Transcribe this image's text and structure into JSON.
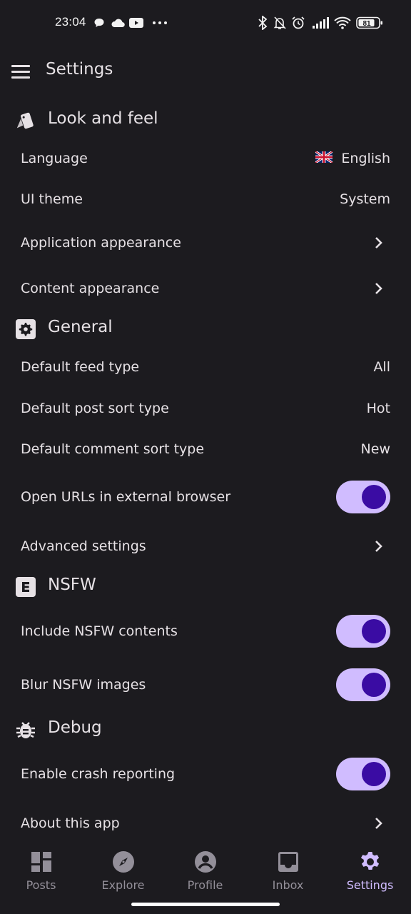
{
  "status_bar": {
    "time": "23:04",
    "battery": "81",
    "left_icons": [
      "chat-bubble-icon",
      "cloud-icon",
      "youtube-icon",
      "more-dots-icon"
    ],
    "right_icons": [
      "bluetooth-icon",
      "bell-off-icon",
      "alarm-icon",
      "signal-icon",
      "wifi-icon",
      "battery-icon"
    ]
  },
  "app_bar": {
    "title": "Settings",
    "menu_icon": "hamburger-menu-icon"
  },
  "sections": [
    {
      "title": "Look and feel",
      "icon": "palette-cards-icon",
      "rows": [
        {
          "label": "Language",
          "value": "English",
          "flag": "uk-flag-icon",
          "type": "value"
        },
        {
          "label": "UI theme",
          "value": "System",
          "type": "value"
        },
        {
          "label": "Application appearance",
          "type": "chevron"
        },
        {
          "label": "Content appearance",
          "type": "chevron"
        }
      ]
    },
    {
      "title": "General",
      "icon": "gear-box-icon",
      "rows": [
        {
          "label": "Default feed type",
          "value": "All",
          "type": "value"
        },
        {
          "label": "Default post sort type",
          "value": "Hot",
          "type": "value"
        },
        {
          "label": "Default comment sort type",
          "value": "New",
          "type": "value"
        },
        {
          "label": "Open URLs in external browser",
          "type": "toggle",
          "checked": true
        },
        {
          "label": "Advanced settings",
          "type": "chevron"
        }
      ]
    },
    {
      "title": "NSFW",
      "icon": "explicit-icon",
      "rows": [
        {
          "label": "Include NSFW contents",
          "type": "toggle",
          "checked": true
        },
        {
          "label": "Blur NSFW images",
          "type": "toggle",
          "checked": true
        }
      ]
    },
    {
      "title": "Debug",
      "icon": "bug-icon",
      "rows": [
        {
          "label": "Enable crash reporting",
          "type": "toggle",
          "checked": true
        },
        {
          "label": "About this app",
          "type": "chevron"
        }
      ]
    }
  ],
  "bottom_nav": {
    "items": [
      {
        "label": "Posts",
        "icon": "dashboard-icon",
        "active": false
      },
      {
        "label": "Explore",
        "icon": "compass-icon",
        "active": false
      },
      {
        "label": "Profile",
        "icon": "account-circle-icon",
        "active": false
      },
      {
        "label": "Inbox",
        "icon": "inbox-icon",
        "active": false
      },
      {
        "label": "Settings",
        "icon": "gear-icon",
        "active": true
      }
    ]
  },
  "colors": {
    "background": "#1c1b1f",
    "text": "#e6e1e5",
    "accent": "#d0bcff",
    "toggle_knob": "#3a0ca3",
    "nav_inactive": "#938f99"
  }
}
